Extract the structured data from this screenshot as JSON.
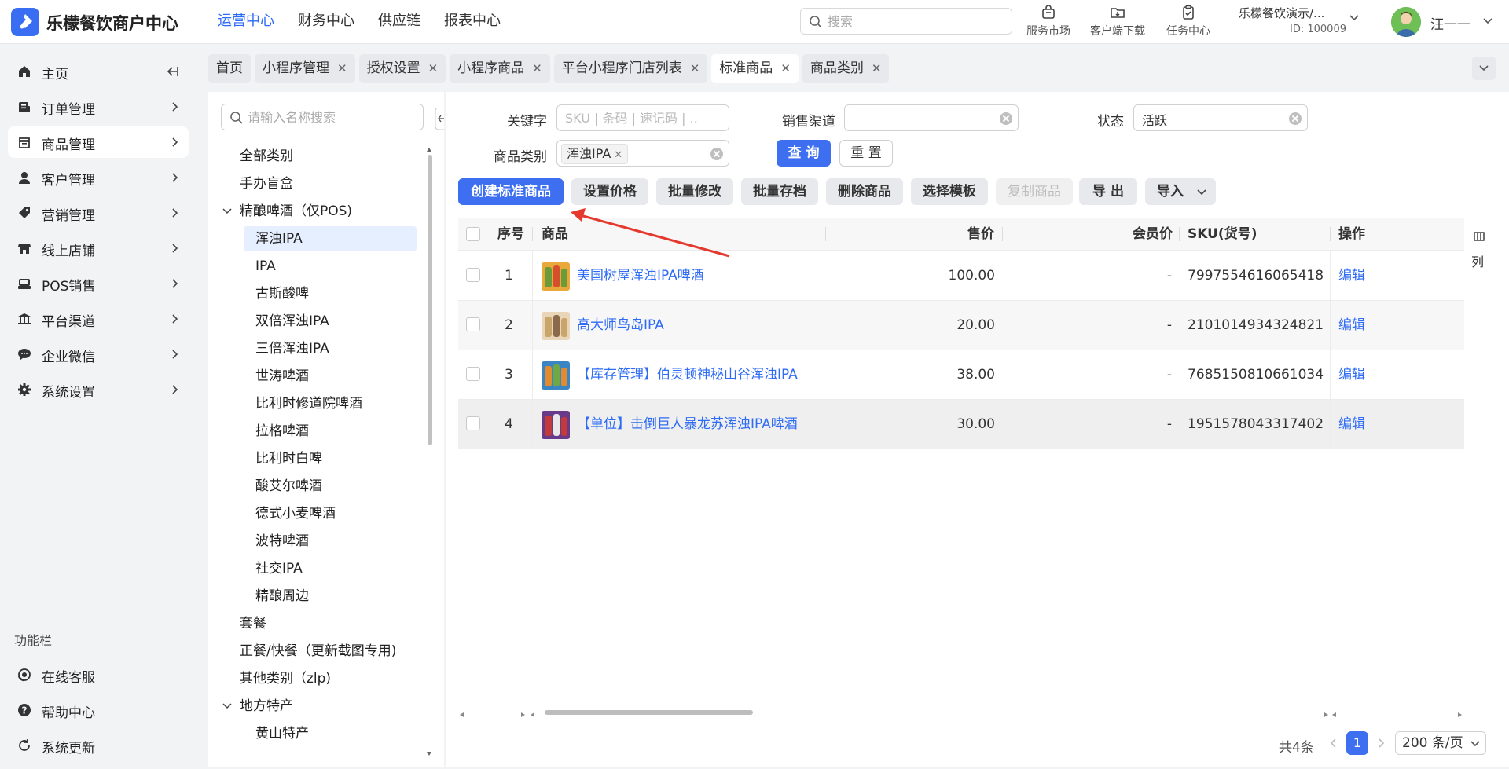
{
  "header": {
    "brand": "乐檬餐饮商户中心",
    "nav": [
      "运营中心",
      "财务中心",
      "供应链",
      "报表中心"
    ],
    "search_placeholder": "搜索",
    "tools": [
      "服务市场",
      "客户端下载",
      "任务中心"
    ],
    "tenant_name": "乐檬餐饮演示/...",
    "tenant_id": "ID: 100009",
    "user_name": "汪一一"
  },
  "sidebar": {
    "items": [
      {
        "label": "主页",
        "icon": "home-icon"
      },
      {
        "label": "订单管理",
        "icon": "order-icon"
      },
      {
        "label": "商品管理",
        "icon": "goods-icon"
      },
      {
        "label": "客户管理",
        "icon": "user-icon"
      },
      {
        "label": "营销管理",
        "icon": "tag-icon"
      },
      {
        "label": "线上店铺",
        "icon": "store-icon"
      },
      {
        "label": "POS销售",
        "icon": "pos-icon"
      },
      {
        "label": "平台渠道",
        "icon": "bank-icon"
      },
      {
        "label": "企业微信",
        "icon": "chat-icon"
      },
      {
        "label": "系统设置",
        "icon": "gear-icon"
      }
    ],
    "func_title": "功能栏",
    "func_items": [
      {
        "label": "在线客服",
        "icon": "service-icon"
      },
      {
        "label": "帮助中心",
        "icon": "help-icon"
      },
      {
        "label": "系统更新",
        "icon": "refresh-icon"
      }
    ]
  },
  "tabs": [
    "首页",
    "小程序管理",
    "授权设置",
    "小程序商品",
    "平台小程序门店列表",
    "标准商品",
    "商品类别"
  ],
  "category": {
    "search_placeholder": "请输入名称搜索",
    "nodes": [
      {
        "label": "全部类别",
        "level": 1
      },
      {
        "label": "手办盲盒",
        "level": 1
      },
      {
        "label": "精酿啤酒（仅POS)",
        "level": 1,
        "expanded": true
      },
      {
        "label": "浑浊IPA",
        "level": 2,
        "selected": true
      },
      {
        "label": "IPA",
        "level": 2
      },
      {
        "label": "古斯酸啤",
        "level": 2
      },
      {
        "label": "双倍浑浊IPA",
        "level": 2
      },
      {
        "label": "三倍浑浊IPA",
        "level": 2
      },
      {
        "label": "世涛啤酒",
        "level": 2
      },
      {
        "label": "比利时修道院啤酒",
        "level": 2
      },
      {
        "label": "拉格啤酒",
        "level": 2
      },
      {
        "label": "比利时白啤",
        "level": 2
      },
      {
        "label": "酸艾尔啤酒",
        "level": 2
      },
      {
        "label": "德式小麦啤酒",
        "level": 2
      },
      {
        "label": "波特啤酒",
        "level": 2
      },
      {
        "label": "社交IPA",
        "level": 2
      },
      {
        "label": "精酿周边",
        "level": 2
      },
      {
        "label": "套餐",
        "level": 1
      },
      {
        "label": "正餐/快餐（更新截图专用)",
        "level": 1
      },
      {
        "label": "其他类别（zlp)",
        "level": 1
      },
      {
        "label": "地方特产",
        "level": 1,
        "expanded": true
      },
      {
        "label": "黄山特产",
        "level": 2
      }
    ]
  },
  "filters": {
    "keyword_label": "关键字",
    "keyword_placeholder": "SKU | 条码 | 速记码 | ...",
    "channel_label": "销售渠道",
    "channel_value": "",
    "status_label": "状态",
    "status_value": "活跃",
    "category_label": "商品类别",
    "category_chip": "浑浊IPA",
    "query_btn": "查 询",
    "reset_btn": "重 置"
  },
  "actions": [
    "创建标准商品",
    "设置价格",
    "批量修改",
    "批量存档",
    "删除商品",
    "选择模板",
    "复制商品",
    "导 出",
    "导入"
  ],
  "table": {
    "headers": [
      "序号",
      "商品",
      "售价",
      "会员价",
      "SKU(货号)",
      "操作"
    ],
    "rows": [
      {
        "no": "1",
        "name": "美国树屋浑浊IPA啤酒",
        "price": "100.00",
        "member_price": "-",
        "sku": "7997554616065418",
        "op": "编辑"
      },
      {
        "no": "2",
        "name": "高大师鸟岛IPA",
        "price": "20.00",
        "member_price": "-",
        "sku": "2101014934324821",
        "op": "编辑"
      },
      {
        "no": "3",
        "name": "【库存管理】伯灵顿神秘山谷浑浊IPA",
        "price": "38.00",
        "member_price": "-",
        "sku": "7685150810661034",
        "op": "编辑"
      },
      {
        "no": "4",
        "name": "【单位】击倒巨人暴龙苏浑浊IPA啤酒",
        "price": "30.00",
        "member_price": "-",
        "sku": "1951578043317402",
        "op": "编辑"
      }
    ],
    "col_settings": "列"
  },
  "pagination": {
    "total": "共4条",
    "current": "1",
    "page_size": "200 条/页"
  },
  "colors": {
    "primary": "#3d6ff0",
    "link": "#2f6cf5",
    "annotation": "#e5392e"
  }
}
